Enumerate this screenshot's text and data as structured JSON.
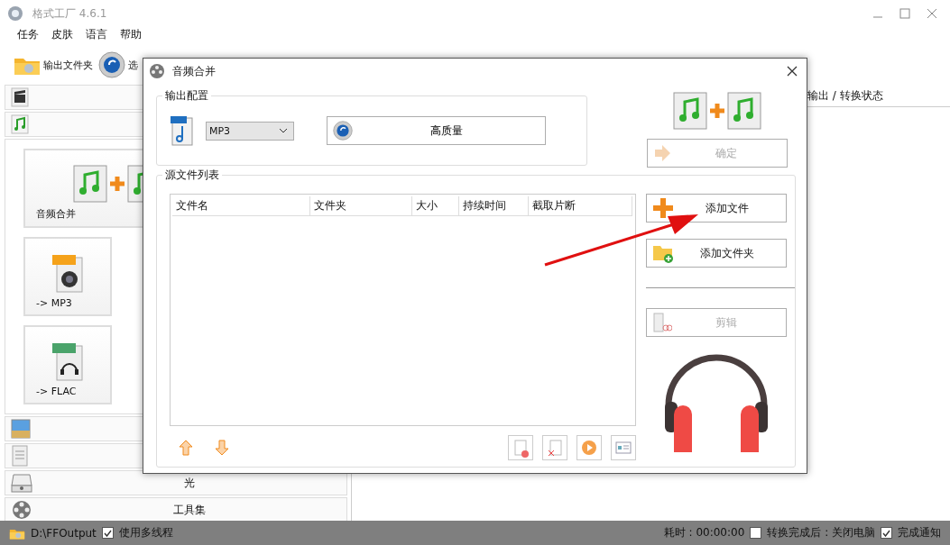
{
  "window": {
    "title": "格式工厂 4.6.1"
  },
  "menu": [
    "任务",
    "皮肤",
    "语言",
    "帮助"
  ],
  "toolbar": [
    {
      "kind": "folder",
      "label": "输出文件夹"
    },
    {
      "kind": "gear",
      "label": "选"
    }
  ],
  "sidebar": {
    "sections": [
      {
        "kind": "video"
      },
      {
        "kind": "audio",
        "tiles": [
          {
            "kind": "merge",
            "label": "音频合并"
          },
          {
            "kind": "mp3",
            "label": "-> MP3"
          },
          {
            "kind": "flac",
            "label": "-> FLAC"
          }
        ]
      },
      {
        "kind": "picture"
      },
      {
        "kind": "document"
      },
      {
        "kind": "disc",
        "label": "光"
      },
      {
        "kind": "tools",
        "label": "工具集"
      }
    ]
  },
  "task_panel": {
    "header": "输出 / 转换状态"
  },
  "dialog": {
    "title": "音频合并",
    "output_config": {
      "legend": "输出配置",
      "format": "MP3",
      "quality_button": "高质量"
    },
    "confirm_button": {
      "label": "确定",
      "disabled": true
    },
    "source_list": {
      "legend": "源文件列表",
      "columns": [
        "文件名",
        "文件夹",
        "大小",
        "持续时间",
        "截取片断"
      ]
    },
    "side_buttons": [
      {
        "kind": "add-file",
        "label": "添加文件",
        "disabled": false
      },
      {
        "kind": "add-folder",
        "label": "添加文件夹",
        "disabled": false
      },
      {
        "kind": "clip",
        "label": "剪辑",
        "disabled": true
      }
    ]
  },
  "status_bar": {
    "output_path": "D:\\FFOutput",
    "multithread": {
      "label": "使用多线程",
      "checked": true
    },
    "elapsed": "耗时 : 00:00:00",
    "shutdown": {
      "label": "转换完成后 : 关闭电脑",
      "checked": false
    },
    "notify": {
      "label": "完成通知",
      "checked": true
    }
  }
}
